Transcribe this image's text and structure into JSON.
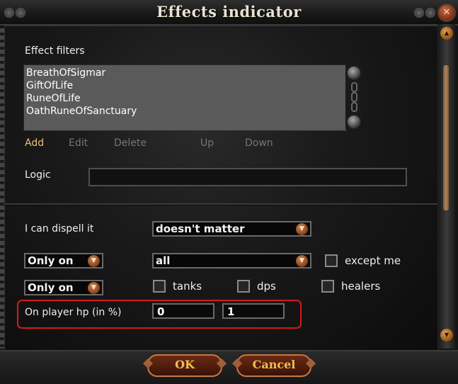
{
  "window": {
    "title": "Effects indicator",
    "close_icon": "close-icon"
  },
  "filters": {
    "label": "Effect filters",
    "items": [
      "BreathOfSigmar",
      "GiftOfLife",
      "RuneOfLife",
      "OathRuneOfSanctuary"
    ],
    "actions": {
      "add": "Add",
      "edit": "Edit",
      "delete": "Delete",
      "up": "Up",
      "down": "Down"
    }
  },
  "logic": {
    "label": "Logic",
    "value": ""
  },
  "dispell": {
    "label": "I can dispell it",
    "value": "doesn't matter"
  },
  "target": {
    "mode": "Only on",
    "group": "all",
    "except_me_label": "except me",
    "except_me_checked": false
  },
  "roles": {
    "mode": "Only on",
    "tanks_label": "tanks",
    "dps_label": "dps",
    "healers_label": "healers"
  },
  "hp": {
    "label": "On player hp (in %)",
    "min": "0",
    "max": "1"
  },
  "footer": {
    "ok_label": "OK",
    "cancel_label": "Cancel"
  },
  "colors": {
    "accent_gold": "#f0c050",
    "highlight_red": "#d41a1a",
    "add_link": "#e8c07a",
    "disabled_link": "#767676"
  }
}
